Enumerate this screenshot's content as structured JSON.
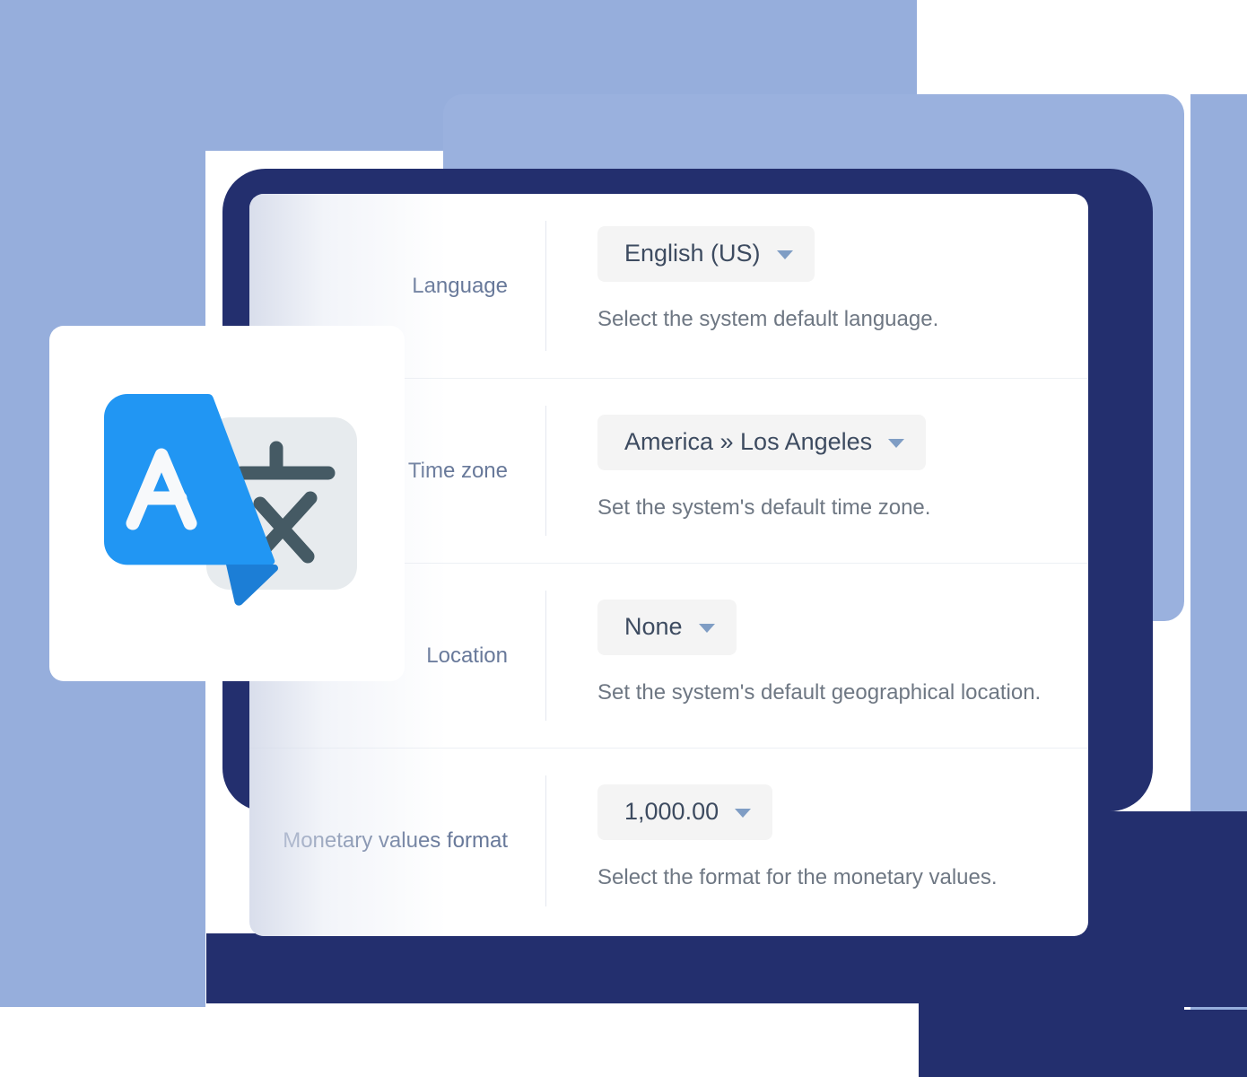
{
  "app": {
    "icon_name": "translate-icon",
    "icon_letter": "A",
    "icon_cjk": "文"
  },
  "colors": {
    "background_blue": "#96aedc",
    "plate_navy": "#232f6e",
    "plate_lightblue": "#9ab1de",
    "card_white": "#ffffff",
    "select_background": "#f4f4f4",
    "label_text": "#68799a",
    "value_text": "#3d4b60",
    "help_text": "#6e7783",
    "caret_blue": "#7f9dc4",
    "icon_blue": "#2196f3",
    "icon_blue_dark": "#1c7ed6",
    "icon_gray_panel": "#e8ecef",
    "icon_glyph_gray": "#455a64"
  },
  "settings": {
    "rows": [
      {
        "label": "Language",
        "value": "English (US)",
        "help": "Select the system default language.",
        "caret": "chevron-down-icon"
      },
      {
        "label": "Time zone",
        "value": "America » Los Angeles",
        "help": "Set the system's default time zone.",
        "caret": "chevron-down-icon"
      },
      {
        "label": "Location",
        "value": "None",
        "help": "Set the system's default geographical location.",
        "caret": "chevron-down-icon"
      },
      {
        "label": "Monetary values format",
        "value": "1,000.00",
        "help": "Select the format for the monetary values.",
        "caret": "chevron-down-icon"
      }
    ]
  }
}
